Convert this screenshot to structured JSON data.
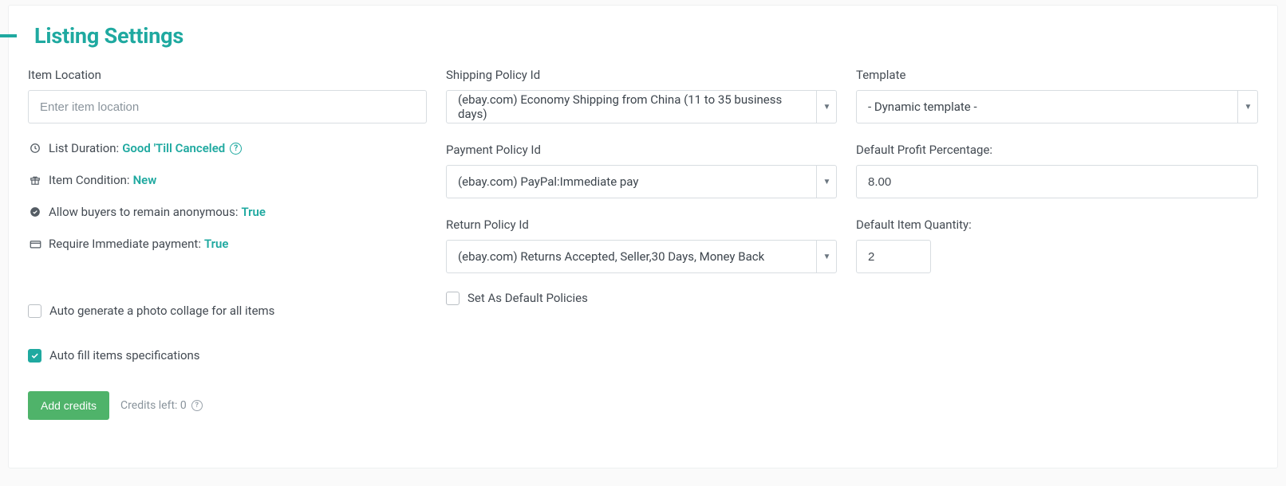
{
  "section": {
    "title": "Listing Settings"
  },
  "col1": {
    "item_location_label": "Item Location",
    "item_location_placeholder": "Enter item location",
    "list_duration_label": "List Duration:",
    "list_duration_value": "Good 'Till Canceled",
    "item_condition_label": "Item Condition:",
    "item_condition_value": "New",
    "anon_label": "Allow buyers to remain anonymous:",
    "anon_value": "True",
    "immediate_label": "Require Immediate payment:",
    "immediate_value": "True",
    "auto_collage_label": "Auto generate a photo collage for all items",
    "auto_fill_label": "Auto fill items specifications",
    "add_credits_btn": "Add credits",
    "credits_left_label": "Credits left: 0"
  },
  "col2": {
    "shipping_label": "Shipping Policy Id",
    "shipping_value": "(ebay.com) Economy Shipping from China (11 to 35 business days)",
    "payment_label": "Payment Policy Id",
    "payment_value": "(ebay.com) PayPal:Immediate pay",
    "return_label": "Return Policy Id",
    "return_value": "(ebay.com) Returns Accepted, Seller,30 Days, Money Back",
    "default_policies_label": "Set As Default Policies"
  },
  "col3": {
    "template_label": "Template",
    "template_value": "- Dynamic template -",
    "profit_label": "Default Profit Percentage:",
    "profit_value": "8.00",
    "qty_label": "Default Item Quantity:",
    "qty_value": "2"
  }
}
